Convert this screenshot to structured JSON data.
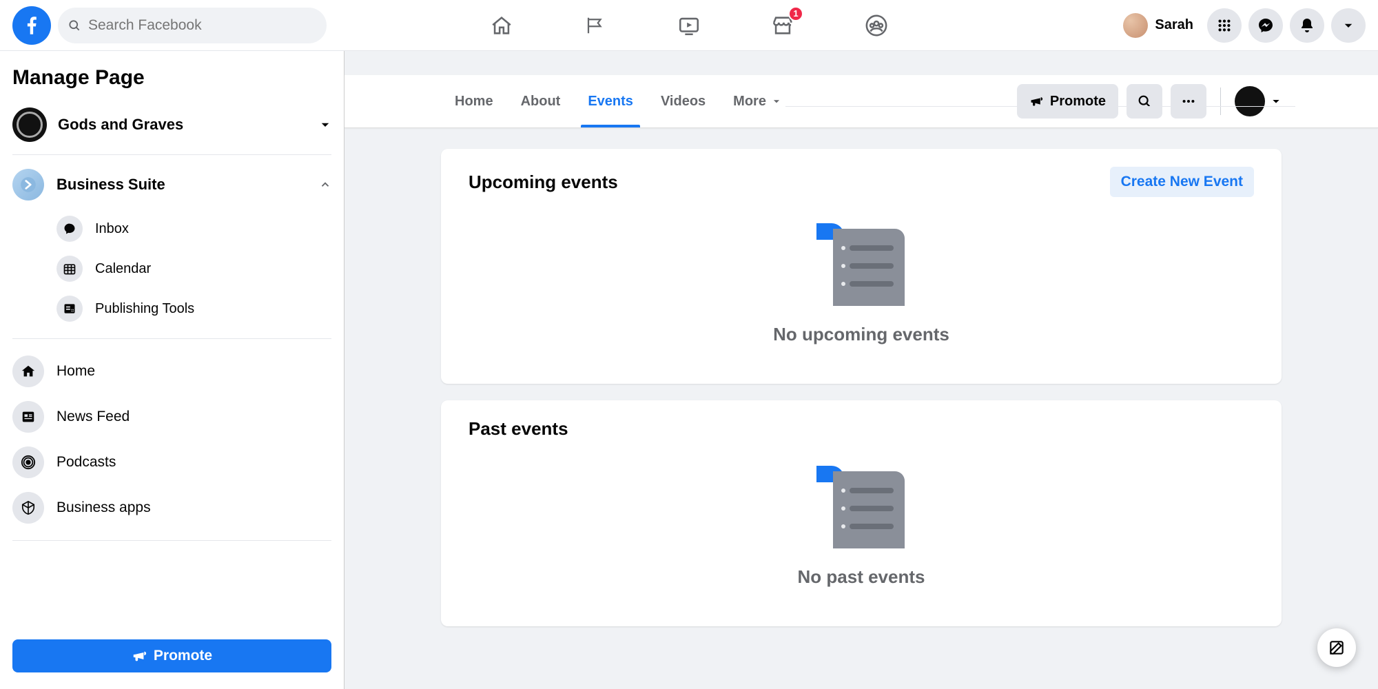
{
  "header": {
    "search_placeholder": "Search Facebook",
    "user_name": "Sarah",
    "marketplace_badge": "1"
  },
  "sidebar": {
    "title": "Manage Page",
    "page_name": "Gods and Graves",
    "business_suite": {
      "label": "Business Suite",
      "items": [
        {
          "label": "Inbox"
        },
        {
          "label": "Calendar"
        },
        {
          "label": "Publishing Tools"
        }
      ]
    },
    "nav": [
      {
        "label": "Home"
      },
      {
        "label": "News Feed"
      },
      {
        "label": "Podcasts"
      },
      {
        "label": "Business apps"
      }
    ],
    "promote_label": "Promote"
  },
  "page_tabs": {
    "items": [
      {
        "label": "Home",
        "active": false
      },
      {
        "label": "About",
        "active": false
      },
      {
        "label": "Events",
        "active": true
      },
      {
        "label": "Videos",
        "active": false
      },
      {
        "label": "More",
        "active": false,
        "dropdown": true
      }
    ],
    "promote_label": "Promote"
  },
  "cards": {
    "upcoming": {
      "title": "Upcoming events",
      "create_label": "Create New Event",
      "empty_text": "No upcoming events"
    },
    "past": {
      "title": "Past events",
      "empty_text": "No past events"
    }
  }
}
